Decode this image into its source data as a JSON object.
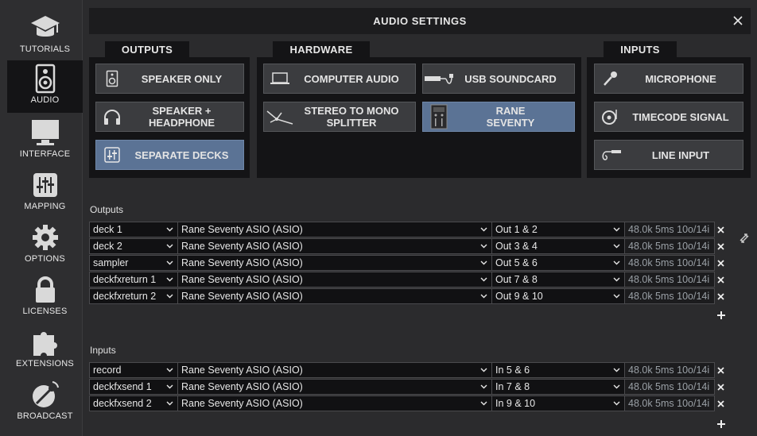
{
  "sidebar": {
    "items": [
      {
        "label": "TUTORIALS",
        "icon": "graduation-cap-icon"
      },
      {
        "label": "AUDIO",
        "icon": "speaker-icon",
        "active": true
      },
      {
        "label": "INTERFACE",
        "icon": "monitor-icon"
      },
      {
        "label": "MAPPING",
        "icon": "sliders-icon"
      },
      {
        "label": "OPTIONS",
        "icon": "gear-icon"
      },
      {
        "label": "LICENSES",
        "icon": "lock-icon"
      },
      {
        "label": "EXTENSIONS",
        "icon": "puzzle-icon"
      },
      {
        "label": "BROADCAST",
        "icon": "satellite-dish-icon"
      }
    ]
  },
  "window": {
    "title": "AUDIO SETTINGS"
  },
  "tabs": {
    "outputs": "OUTPUTS",
    "hardware": "HARDWARE",
    "inputs": "INPUTS"
  },
  "outputs_buttons": {
    "speaker_only": "SPEAKER ONLY",
    "speaker_headphone": "SPEAKER +\nHEADPHONE",
    "separate_decks": "SEPARATE DECKS"
  },
  "hardware_buttons": {
    "computer_audio": "COMPUTER AUDIO",
    "usb_soundcard": "USB SOUNDCARD",
    "stereo_mono": "STEREO TO MONO\nSPLITTER",
    "rane_seventy": "RANE\nSEVENTY"
  },
  "inputs_buttons": {
    "microphone": "MICROPHONE",
    "timecode": "TIMECODE SIGNAL",
    "line_input": "LINE INPUT"
  },
  "outputs_section": {
    "label": "Outputs",
    "rows": [
      {
        "channel": "deck 1",
        "device": "Rane Seventy ASIO (ASIO)",
        "port": "Out 1 & 2",
        "info": "48.0k 5ms 10o/14i"
      },
      {
        "channel": "deck 2",
        "device": "Rane Seventy ASIO (ASIO)",
        "port": "Out 3 & 4",
        "info": "48.0k 5ms 10o/14i"
      },
      {
        "channel": "sampler",
        "device": "Rane Seventy ASIO (ASIO)",
        "port": "Out 5 & 6",
        "info": "48.0k 5ms 10o/14i"
      },
      {
        "channel": "deckfxreturn 1",
        "device": "Rane Seventy ASIO (ASIO)",
        "port": "Out 7 & 8",
        "info": "48.0k 5ms 10o/14i"
      },
      {
        "channel": "deckfxreturn 2",
        "device": "Rane Seventy ASIO (ASIO)",
        "port": "Out 9 & 10",
        "info": "48.0k 5ms 10o/14i"
      }
    ]
  },
  "inputs_section": {
    "label": "Inputs",
    "rows": [
      {
        "channel": "record",
        "device": "Rane Seventy ASIO (ASIO)",
        "port": "In 5 & 6",
        "info": "48.0k 5ms 10o/14i"
      },
      {
        "channel": "deckfxsend 1",
        "device": "Rane Seventy ASIO (ASIO)",
        "port": "In 7 & 8",
        "info": "48.0k 5ms 10o/14i"
      },
      {
        "channel": "deckfxsend 2",
        "device": "Rane Seventy ASIO (ASIO)",
        "port": "In 9 & 10",
        "info": "48.0k 5ms 10o/14i"
      }
    ]
  },
  "colors": {
    "selected": "#5b7395",
    "panel": "#141416",
    "background": "#2b2b2d"
  }
}
